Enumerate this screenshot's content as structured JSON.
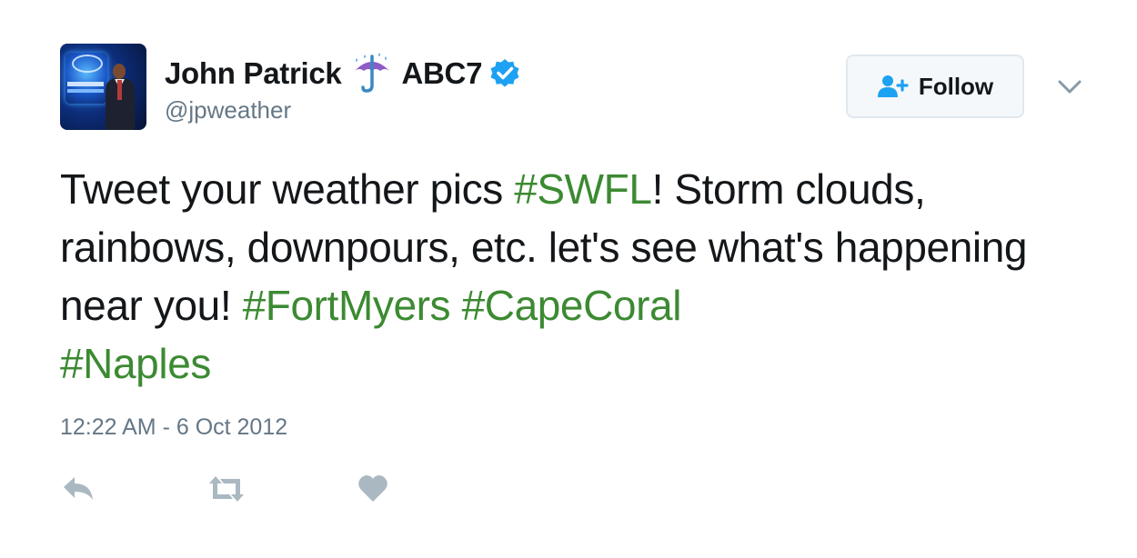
{
  "author": {
    "name": "John Patrick",
    "name_suffix": "ABC7",
    "handle": "@jpweather",
    "verified": true,
    "emoji": "umbrella-with-rain-icon"
  },
  "follow_button": {
    "label": "Follow",
    "icon": "add-user-icon"
  },
  "menu": {
    "icon": "chevron-down-icon"
  },
  "tweet": {
    "segments": [
      {
        "text": "Tweet your weather pics ",
        "type": "text"
      },
      {
        "text": "#SWFL",
        "type": "hashtag"
      },
      {
        "text": "! Storm clouds, rainbows, downpours, etc. let's see what's happening near you! ",
        "type": "text"
      },
      {
        "text": "#FortMyers",
        "type": "hashtag"
      },
      {
        "text": " ",
        "type": "text"
      },
      {
        "text": "#CapeCoral",
        "type": "hashtag"
      },
      {
        "text": " ",
        "type": "text"
      },
      {
        "text": "#Naples",
        "type": "hashtag"
      }
    ],
    "timestamp": "12:22 AM - 6 Oct 2012"
  },
  "actions": [
    {
      "name": "reply",
      "icon": "reply-icon"
    },
    {
      "name": "retweet",
      "icon": "retweet-icon"
    },
    {
      "name": "like",
      "icon": "heart-icon"
    }
  ],
  "colors": {
    "text": "#14171a",
    "secondary": "#657786",
    "hashtag": "#3c8a32",
    "verified": "#1da1f2",
    "action_icons": "#aab8c2"
  }
}
